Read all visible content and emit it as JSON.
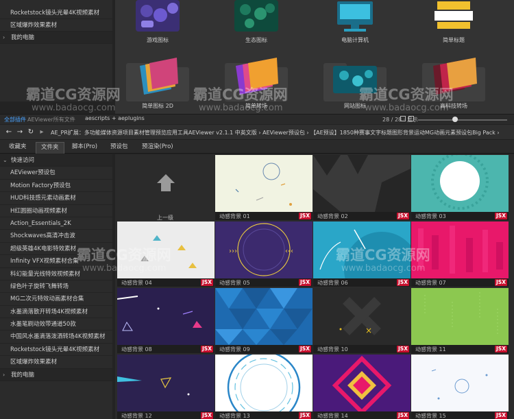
{
  "top_sidebar": {
    "items": [
      {
        "label": "Rocketstock镜头光晕4K视频素材",
        "folder": false
      },
      {
        "label": "区域爆炸效果素材",
        "folder": false
      },
      {
        "label": "我的电脑",
        "folder": true
      }
    ]
  },
  "top_grid": {
    "row1": [
      "游戏图标",
      "生态图标",
      "电脑计算机",
      "简单标题"
    ],
    "row2": [
      "简单图标 2D",
      "简单转场",
      "网站图标",
      "高科技转场"
    ]
  },
  "tabbar_top": {
    "left": "全部插件",
    "middle": "AEViewer所有文件",
    "plugin": "aescripts + aeplugins",
    "count": "28 / 28 · 显示"
  },
  "path": {
    "back": "←",
    "forward": "→",
    "refresh": "↻",
    "up": "▸",
    "text": "AE_PR扩展：多功能媒体资源项目素材管理预览应用工具AEViewer v2.1.1 中英文版  ›  AEViewer预设包  ›  【AE预设】1850种赛事文字标题图形背景运动MG动画元素预设包Big Pack  ›"
  },
  "tabs": [
    "收藏夹",
    "文件夹",
    "脚本(Pro)",
    "预设包",
    "预渲染(Pro)"
  ],
  "sidebar": {
    "header": "快速访问",
    "items": [
      "AEViewer预设包",
      "Motion Factory预设包",
      "HUD科技感元素动画素材",
      "H红圆圈动画视频素材",
      "Action_Essentials_2K",
      "Shockwaves高清冲击波",
      "超级英雄4K电影特效素材",
      "Infinity VFX视频素材合集",
      "科幻能量光线特效视频素材",
      "绿色叶子旋转飞舞转场",
      "MG二次元特效动画素材合集",
      "水墨滴落散开转场4K视频素材",
      "水墨笔刷动效带通道50款",
      "中国风水墨滴落泼洒转场4K视频素材",
      "Rocketstock镜头光晕4K视频素材",
      "区域爆炸效果素材"
    ],
    "footer": "我的电脑"
  },
  "grid": {
    "up_label": "上一级",
    "badge": "JSX",
    "items": [
      {
        "label": "动感背景 01"
      },
      {
        "label": "动感背景 02"
      },
      {
        "label": "动感背景 03"
      },
      {
        "label": "动感背景 04"
      },
      {
        "label": "动感背景 05"
      },
      {
        "label": "动感背景 06"
      },
      {
        "label": "动感背景 07"
      },
      {
        "label": "动感背景 08"
      },
      {
        "label": "动感背景 09"
      },
      {
        "label": "动感背景 10"
      },
      {
        "label": "动感背景 11"
      },
      {
        "label": "动感背景 12"
      },
      {
        "label": "动感背景 13"
      },
      {
        "label": "动感背景 14"
      },
      {
        "label": "动感背景 15"
      }
    ]
  },
  "watermark": {
    "text": "霸道CG资源网",
    "url": "www.badaocg.com"
  },
  "colors": {
    "badge": "#c8102e",
    "accent_tab": "#4aa3ff"
  }
}
